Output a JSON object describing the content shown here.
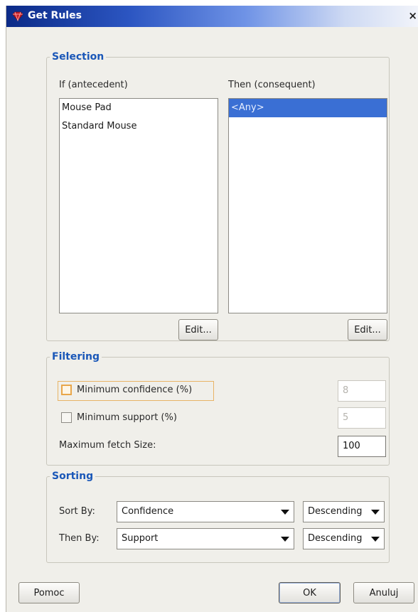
{
  "window": {
    "title": "Get Rules",
    "close": "×"
  },
  "selection": {
    "legend": "Selection",
    "if_label": "If (antecedent)",
    "then_label": "Then (consequent)",
    "if_items": [
      "Mouse Pad",
      "Standard Mouse"
    ],
    "then_items": [
      "<Any>"
    ],
    "edit_label": "Edit..."
  },
  "filtering": {
    "legend": "Filtering",
    "min_confidence": {
      "label": "Minimum confidence (%)",
      "checked": false,
      "value": "8"
    },
    "min_support": {
      "label": "Minimum support (%)",
      "checked": false,
      "value": "5"
    },
    "max_fetch": {
      "label": "Maximum fetch Size:",
      "value": "100"
    }
  },
  "sorting": {
    "legend": "Sorting",
    "sort_by_label": "Sort By:",
    "sort_by_value": "Confidence",
    "sort_by_order": "Descending",
    "then_by_label": "Then By:",
    "then_by_value": "Support",
    "then_by_order": "Descending"
  },
  "buttons": {
    "help": "Pomoc",
    "ok": "OK",
    "cancel": "Anuluj"
  },
  "colors": {
    "accent": "#1a57b8",
    "selection": "#3a6fd4",
    "focus": "#e8a64a"
  }
}
